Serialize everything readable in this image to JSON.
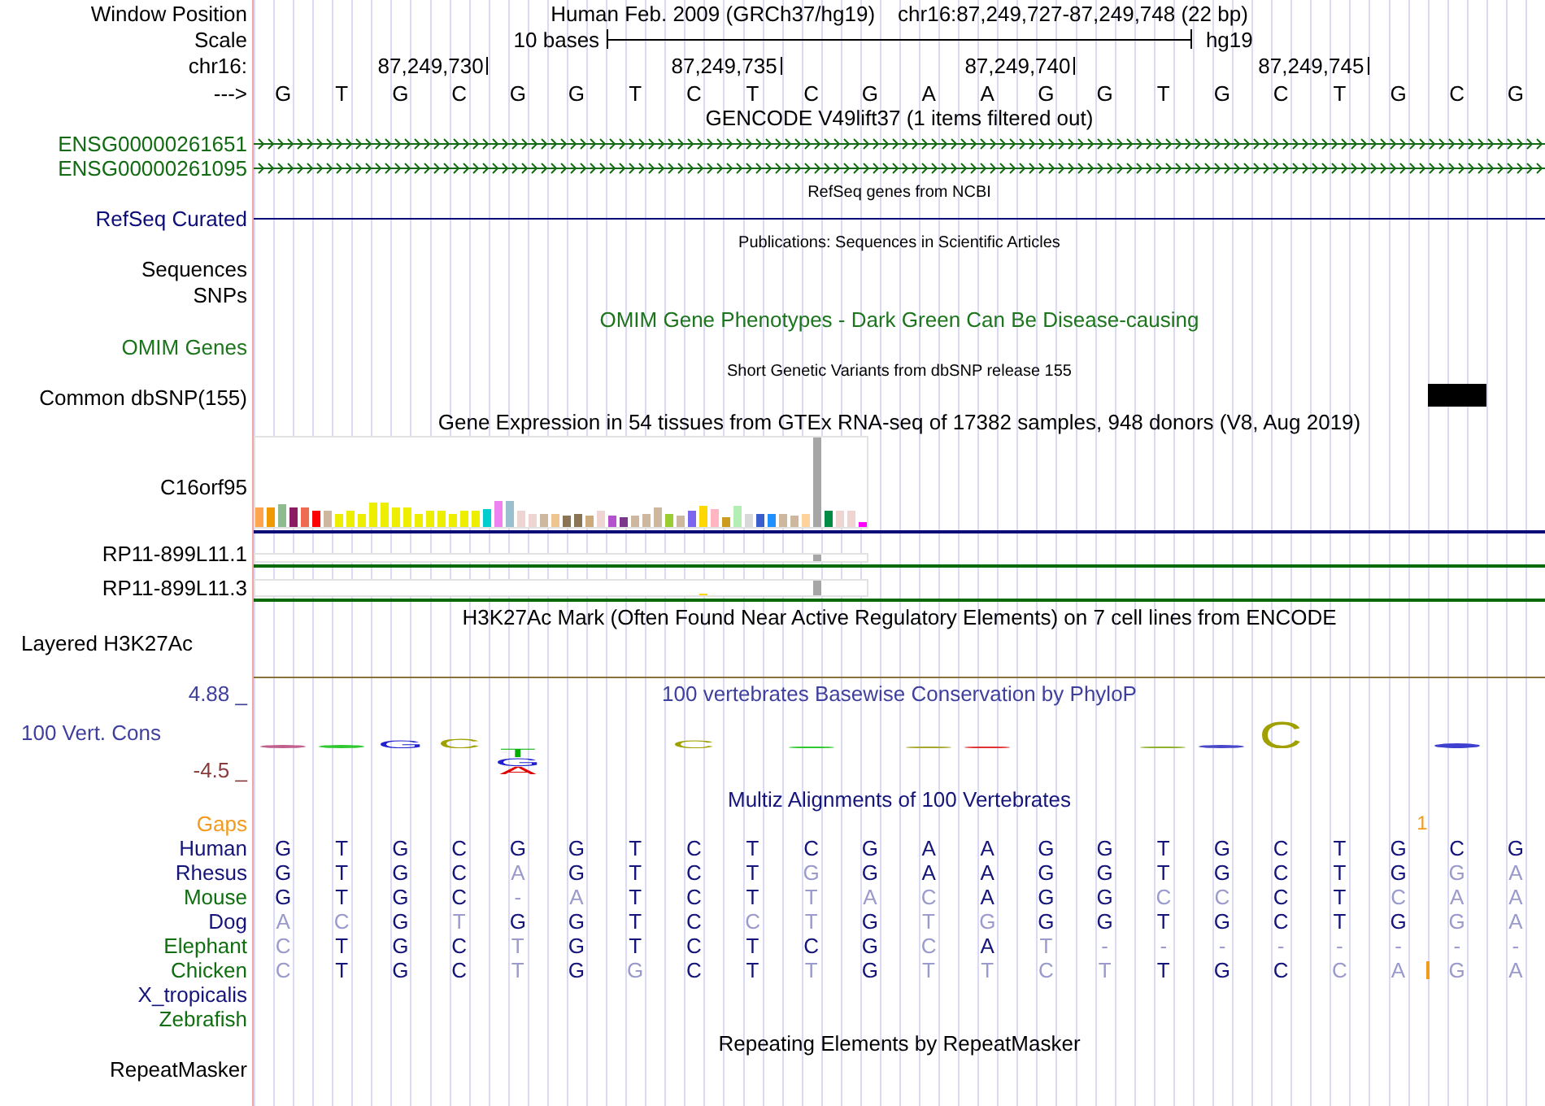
{
  "header": {
    "label": "Window Position",
    "assembly": "Human Feb. 2009 (GRCh37/hg19)",
    "position": "chr16:87,249,727-87,249,748 (22 bp)"
  },
  "scale": {
    "label": "Scale",
    "length": "10 bases",
    "assembly_tag": "hg19"
  },
  "ruler": {
    "label": "chr16:",
    "ticks": [
      "87,249,730",
      "87,249,735",
      "87,249,740",
      "87,249,745"
    ]
  },
  "sequence": {
    "label": "--->",
    "bases": [
      "G",
      "T",
      "G",
      "C",
      "G",
      "G",
      "T",
      "C",
      "T",
      "C",
      "G",
      "A",
      "A",
      "G",
      "G",
      "T",
      "G",
      "C",
      "T",
      "G",
      "C",
      "G"
    ]
  },
  "tracks": [
    {
      "kind": "transcripts",
      "title": "GENCODE V49lift37 (1 items filtered out)",
      "color": "#000000",
      "items": [
        {
          "label": "ENSG00000261651",
          "color": "#126b12"
        },
        {
          "label": "ENSG00000261095",
          "color": "#126b12"
        }
      ]
    },
    {
      "kind": "curated",
      "title": "RefSeq genes from NCBI",
      "color": "#000000",
      "items": [
        {
          "label": "RefSeq Curated",
          "color": "#0c0c78"
        }
      ]
    },
    {
      "kind": "publications",
      "title": "Publications: Sequences in Scientific Articles",
      "color": "#000000",
      "items": [
        {
          "label": "Sequences",
          "color": "#000000"
        },
        {
          "label": "SNPs",
          "color": "#000000"
        }
      ]
    },
    {
      "kind": "phenotypes",
      "title": "OMIM Gene Phenotypes - Dark Green Can Be Disease-causing",
      "color": "#1c741c",
      "items": [
        {
          "label": "OMIM Genes",
          "color": "#1c741c"
        }
      ]
    },
    {
      "kind": "variants",
      "title": "Short Genetic Variants from dbSNP release 155",
      "color": "#000000",
      "items": [
        {
          "label": "Common dbSNP(155)",
          "color": "#000000",
          "variants": [
            {
              "variant": false
            },
            {
              "variant": false
            },
            {
              "variant": false
            },
            {
              "variant": false
            },
            {
              "variant": false
            },
            {
              "variant": false
            },
            {
              "variant": false
            },
            {
              "variant": false
            },
            {
              "variant": false
            },
            {
              "variant": false
            },
            {
              "variant": false
            },
            {
              "variant": false
            },
            {
              "variant": false
            },
            {
              "variant": false
            },
            {
              "variant": false
            },
            {
              "variant": false
            },
            {
              "variant": false
            },
            {
              "variant": false
            },
            {
              "variant": false
            },
            {
              "variant": false
            },
            {
              "variant": true
            },
            {
              "variant": false
            }
          ]
        }
      ]
    },
    {
      "kind": "expression",
      "title": "Gene Expression in 54 tissues from GTEx RNA-seq of 17382 samples, 948 donors (V8, Aug 2019)",
      "color": "#000000",
      "items": [
        {
          "label": "C16orf95",
          "color": "#0c0c78"
        },
        {
          "label": "RP11-899L11.1",
          "color": "#0a6a0a"
        },
        {
          "label": "RP11-899L11.3",
          "color": "#0a6a0a"
        }
      ]
    },
    {
      "kind": "signal",
      "title": "H3K27Ac Mark (Often Found Near Active Regulatory Elements) on 7 cell lines from ENCODE",
      "color": "#000000",
      "items": [
        {
          "label": "Layered H3K27Ac",
          "color": "#86723a"
        }
      ]
    },
    {
      "kind": "conservation",
      "title": "100 vertebrates Basewise Conservation by PhyloP",
      "color": "#3f3f9e",
      "label": "100 Vert. Cons",
      "max_label": {
        "text": "4.88 _",
        "color": "#3f3f9e"
      },
      "min_label": {
        "text": "-4.5 _",
        "color": "#8a3b3b"
      },
      "logo": [
        {
          "kind": "flat",
          "color": "#c0608c"
        },
        {
          "kind": "flat",
          "color": "#30c830"
        },
        {
          "kind": "letter",
          "letter": "G",
          "color": "#2020d0"
        },
        {
          "kind": "letter",
          "letter": "C",
          "color": "#a0a000"
        },
        {
          "kind": "letter",
          "letter": "T",
          "color": "#00b000"
        },
        {
          "kind": "letter",
          "letter": "G",
          "color": "#2020d0"
        },
        {
          "kind": "letter",
          "letter": "A",
          "color": "#e00000"
        },
        {
          "kind": "letter",
          "letter": "C",
          "color": "#a0a000"
        },
        {
          "kind": "flat",
          "color": "#30c830"
        },
        {
          "kind": "flat",
          "color": "#a8a830"
        },
        {
          "kind": "flat",
          "color": "#e03030"
        },
        {
          "kind": "flat",
          "color": "#90b030"
        },
        {
          "kind": "flat",
          "color": "#4848c8"
        },
        {
          "kind": "letter",
          "letter": "C",
          "color": "#a0a000"
        },
        {
          "kind": "flat",
          "color": "#4040d0"
        }
      ]
    },
    {
      "kind": "alignment",
      "title": "Multiz Alignments of 100 Vertebrates",
      "color": "#14147a",
      "gaps": {
        "label": "Gaps",
        "color": "#f39a1c",
        "counts": [
          "1"
        ]
      },
      "species": [
        {
          "label": "Human",
          "color": "#14147a",
          "bases": [
            {
              "base": "G",
              "match": true
            },
            {
              "base": "T",
              "match": true
            },
            {
              "base": "G",
              "match": true
            },
            {
              "base": "C",
              "match": true
            },
            {
              "base": "G",
              "match": true
            },
            {
              "base": "G",
              "match": true
            },
            {
              "base": "T",
              "match": true
            },
            {
              "base": "C",
              "match": true
            },
            {
              "base": "T",
              "match": true
            },
            {
              "base": "C",
              "match": true
            },
            {
              "base": "G",
              "match": true
            },
            {
              "base": "A",
              "match": true
            },
            {
              "base": "A",
              "match": true
            },
            {
              "base": "G",
              "match": true
            },
            {
              "base": "G",
              "match": true
            },
            {
              "base": "T",
              "match": true
            },
            {
              "base": "G",
              "match": true
            },
            {
              "base": "C",
              "match": true
            },
            {
              "base": "T",
              "match": true
            },
            {
              "base": "G",
              "match": true
            },
            {
              "base": "C",
              "match": true
            },
            {
              "base": "G",
              "match": true
            }
          ]
        },
        {
          "label": "Rhesus",
          "color": "#14147a",
          "bases": [
            {
              "base": "G",
              "match": true
            },
            {
              "base": "T",
              "match": true
            },
            {
              "base": "G",
              "match": true
            },
            {
              "base": "C",
              "match": true
            },
            {
              "base": "A",
              "match": false
            },
            {
              "base": "G",
              "match": true
            },
            {
              "base": "T",
              "match": true
            },
            {
              "base": "C",
              "match": true
            },
            {
              "base": "T",
              "match": true
            },
            {
              "base": "G",
              "match": false
            },
            {
              "base": "G",
              "match": true
            },
            {
              "base": "A",
              "match": true
            },
            {
              "base": "A",
              "match": true
            },
            {
              "base": "G",
              "match": true
            },
            {
              "base": "G",
              "match": true
            },
            {
              "base": "T",
              "match": true
            },
            {
              "base": "G",
              "match": true
            },
            {
              "base": "C",
              "match": true
            },
            {
              "base": "T",
              "match": true
            },
            {
              "base": "G",
              "match": true
            },
            {
              "base": "G",
              "match": false
            },
            {
              "base": "A",
              "match": false
            }
          ]
        },
        {
          "label": "Mouse",
          "color": "#0f6e0f",
          "bases": [
            {
              "base": "G",
              "match": true
            },
            {
              "base": "T",
              "match": true
            },
            {
              "base": "G",
              "match": true
            },
            {
              "base": "C",
              "match": true
            },
            {
              "base": "-",
              "match": false
            },
            {
              "base": "A",
              "match": false
            },
            {
              "base": "T",
              "match": true
            },
            {
              "base": "C",
              "match": true
            },
            {
              "base": "T",
              "match": true
            },
            {
              "base": "T",
              "match": false
            },
            {
              "base": "A",
              "match": false
            },
            {
              "base": "C",
              "match": false
            },
            {
              "base": "A",
              "match": true
            },
            {
              "base": "G",
              "match": true
            },
            {
              "base": "G",
              "match": true
            },
            {
              "base": "C",
              "match": false
            },
            {
              "base": "C",
              "match": false
            },
            {
              "base": "C",
              "match": true
            },
            {
              "base": "T",
              "match": true
            },
            {
              "base": "C",
              "match": false
            },
            {
              "base": "A",
              "match": false
            },
            {
              "base": "A",
              "match": false
            }
          ]
        },
        {
          "label": "Dog",
          "color": "#14147a",
          "bases": [
            {
              "base": "A",
              "match": false
            },
            {
              "base": "C",
              "match": false
            },
            {
              "base": "G",
              "match": true
            },
            {
              "base": "T",
              "match": false
            },
            {
              "base": "G",
              "match": true
            },
            {
              "base": "G",
              "match": true
            },
            {
              "base": "T",
              "match": true
            },
            {
              "base": "C",
              "match": true
            },
            {
              "base": "C",
              "match": false
            },
            {
              "base": "T",
              "match": false
            },
            {
              "base": "G",
              "match": true
            },
            {
              "base": "T",
              "match": false
            },
            {
              "base": "G",
              "match": false
            },
            {
              "base": "G",
              "match": true
            },
            {
              "base": "G",
              "match": true
            },
            {
              "base": "T",
              "match": true
            },
            {
              "base": "G",
              "match": true
            },
            {
              "base": "C",
              "match": true
            },
            {
              "base": "T",
              "match": true
            },
            {
              "base": "G",
              "match": true
            },
            {
              "base": "G",
              "match": false
            },
            {
              "base": "A",
              "match": false
            }
          ]
        },
        {
          "label": "Elephant",
          "color": "#0f6e0f",
          "bases": [
            {
              "base": "C",
              "match": false
            },
            {
              "base": "T",
              "match": true
            },
            {
              "base": "G",
              "match": true
            },
            {
              "base": "C",
              "match": true
            },
            {
              "base": "T",
              "match": false
            },
            {
              "base": "G",
              "match": true
            },
            {
              "base": "T",
              "match": true
            },
            {
              "base": "C",
              "match": true
            },
            {
              "base": "T",
              "match": true
            },
            {
              "base": "C",
              "match": true
            },
            {
              "base": "G",
              "match": true
            },
            {
              "base": "C",
              "match": false
            },
            {
              "base": "A",
              "match": true
            },
            {
              "base": "T",
              "match": false
            },
            {
              "base": "-",
              "match": false
            },
            {
              "base": "-",
              "match": false
            },
            {
              "base": "-",
              "match": false
            },
            {
              "base": "-",
              "match": false
            },
            {
              "base": "-",
              "match": false
            },
            {
              "base": "-",
              "match": false
            },
            {
              "base": "-",
              "match": false
            },
            {
              "base": "-",
              "match": false
            }
          ]
        },
        {
          "label": "Chicken",
          "color": "#0f6e0f",
          "bases": [
            {
              "base": "C",
              "match": false,
              "insertion": false
            },
            {
              "base": "T",
              "match": true,
              "insertion": false
            },
            {
              "base": "G",
              "match": true,
              "insertion": false
            },
            {
              "base": "C",
              "match": true,
              "insertion": false
            },
            {
              "base": "T",
              "match": false,
              "insertion": false
            },
            {
              "base": "G",
              "match": true,
              "insertion": false
            },
            {
              "base": "G",
              "match": false,
              "insertion": false
            },
            {
              "base": "C",
              "match": true,
              "insertion": false
            },
            {
              "base": "T",
              "match": true,
              "insertion": false
            },
            {
              "base": "T",
              "match": false,
              "insertion": false
            },
            {
              "base": "G",
              "match": true,
              "insertion": false
            },
            {
              "base": "T",
              "match": false,
              "insertion": false
            },
            {
              "base": "T",
              "match": false,
              "insertion": false
            },
            {
              "base": "C",
              "match": false,
              "insertion": false
            },
            {
              "base": "T",
              "match": false,
              "insertion": false
            },
            {
              "base": "T",
              "match": true,
              "insertion": false
            },
            {
              "base": "G",
              "match": true,
              "insertion": false
            },
            {
              "base": "C",
              "match": true,
              "insertion": false
            },
            {
              "base": "C",
              "match": false,
              "insertion": false
            },
            {
              "base": "A",
              "match": false,
              "insertion": true
            },
            {
              "base": "G",
              "match": false,
              "insertion": false
            },
            {
              "base": "A",
              "match": false,
              "insertion": false
            }
          ]
        },
        {
          "label": "X_tropicalis",
          "color": "#14147a"
        },
        {
          "label": "Zebrafish",
          "color": "#0f6e0f"
        }
      ]
    },
    {
      "kind": "repeats",
      "title": "Repeating Elements by RepeatMasker",
      "color": "#000000",
      "items": [
        {
          "label": "RepeatMasker",
          "color": "#000000"
        }
      ]
    }
  ]
}
